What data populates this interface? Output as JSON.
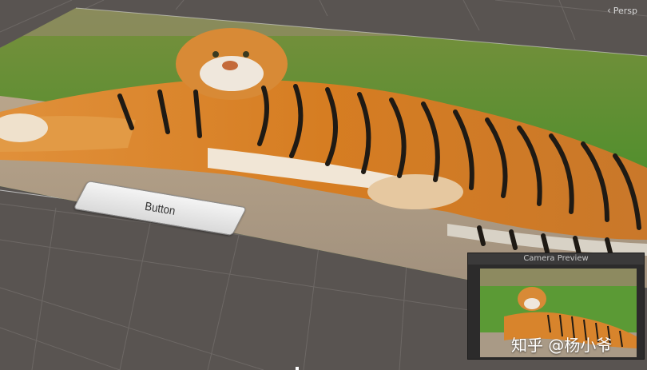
{
  "scene_view": {
    "projection_label": "Persp",
    "projection_icon": "left-chevron-icon"
  },
  "world_button": {
    "label": "Button"
  },
  "camera_preview": {
    "title": "Camera Preview"
  },
  "watermark": {
    "text": "知乎 @杨小爷"
  },
  "colors": {
    "grid_background": "#595451",
    "grass": "#5f9a3a",
    "tiger_orange": "#d98a2b",
    "button_face": "#ececec"
  }
}
